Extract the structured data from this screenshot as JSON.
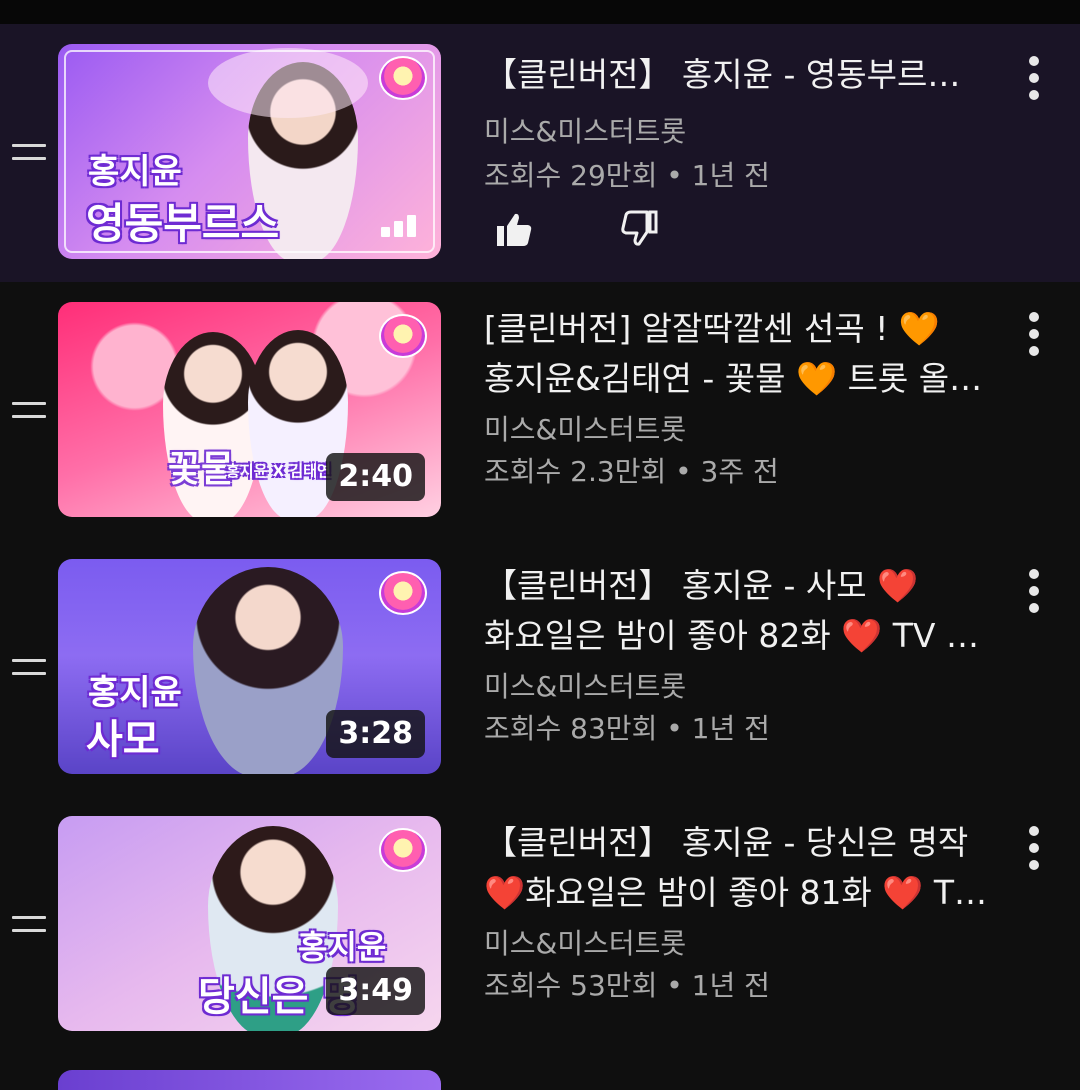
{
  "videos": [
    {
      "title_line1": "【클린버전】 홍지윤 - 영동부르…",
      "title_line2": "",
      "channel": "미스&미스터트롯",
      "meta": "조회수 29만회 • 1년 전",
      "duration": "",
      "now_playing": true,
      "thumb_text_line1": "홍지윤",
      "thumb_text_line2": "영동부르스",
      "thumb_colors": [
        "#b36af5",
        "#ff9fd6"
      ]
    },
    {
      "title_line1": "[클린버전] 알잘딱깔센 선곡 ! 🧡",
      "title_line2": "홍지윤&김태연 - 꽃물 🧡 트롯 올…",
      "channel": "미스&미스터트롯",
      "meta": "조회수 2.3만회 • 3주 전",
      "duration": "2:40",
      "now_playing": false,
      "thumb_text_line1": "꽃물",
      "thumb_text_line2": "홍지윤 X 김태연",
      "thumb_colors": [
        "#ff3d86",
        "#ff9cc0"
      ]
    },
    {
      "title_line1": "【클린버전】 홍지윤 - 사모 ❤️",
      "title_line2": "화요일은 밤이 좋아 82화 ❤️ TV …",
      "channel": "미스&미스터트롯",
      "meta": "조회수 83만회 • 1년 전",
      "duration": "3:28",
      "now_playing": false,
      "thumb_text_line1": "홍지윤",
      "thumb_text_line2": "사모",
      "thumb_colors": [
        "#6a4fe0",
        "#b99cf3"
      ]
    },
    {
      "title_line1": "【클린버전】 홍지윤 - 당신은 명작",
      "title_line2": "❤️화요일은 밤이 좋아 81화 ❤️ T…",
      "channel": "미스&미스터트롯",
      "meta": "조회수 53만회 • 1년 전",
      "duration": "3:49",
      "now_playing": false,
      "thumb_text_line1": "홍지윤",
      "thumb_text_line2": "당신은 명",
      "thumb_colors": [
        "#c08af0",
        "#f2c6ea"
      ]
    }
  ],
  "icons": {
    "drag": "drag-handle-icon",
    "more": "more-vert-icon",
    "like": "thumbs-up-icon",
    "dislike": "thumbs-down-icon",
    "playing": "now-playing-bars-icon"
  },
  "colors": {
    "background": "#0f0f0f",
    "active_row": "#1a1426",
    "secondary_text": "#aaaaaa"
  }
}
